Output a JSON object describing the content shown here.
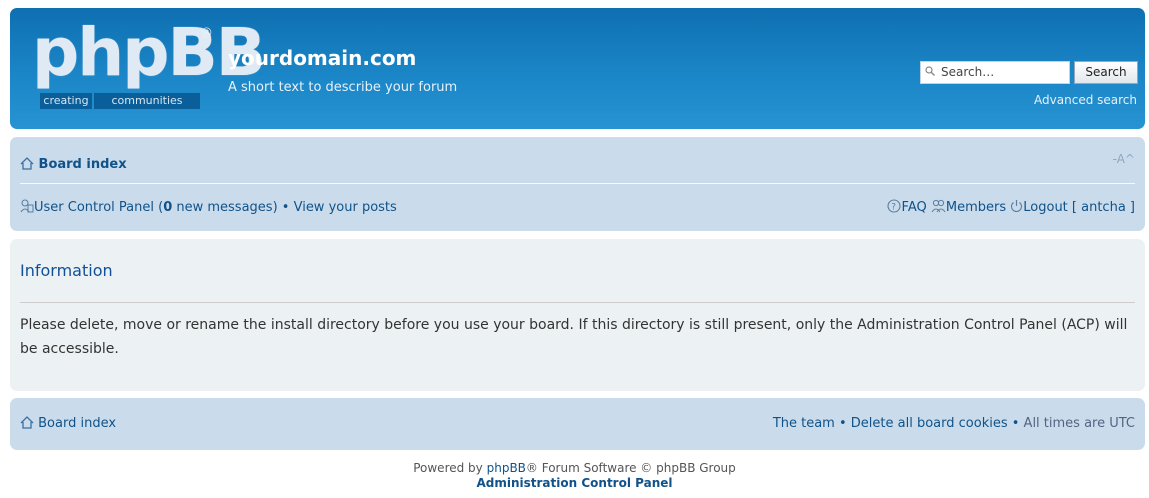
{
  "header": {
    "logo_text": "phpBB",
    "logo_registered": "®",
    "logo_sub1": "creating",
    "logo_sub2": "communities",
    "site_title": "yourdomain.com",
    "site_description": "A short text to describe your forum",
    "search_placeholder": "Search…",
    "search_button": "Search",
    "advanced_search": "Advanced search"
  },
  "navbar": {
    "board_index": "Board index",
    "font_size_control": "-A^",
    "ucp_label": "User Control Panel",
    "new_messages_count": "0",
    "new_messages_text": "new messages",
    "view_posts": "View your posts",
    "faq": "FAQ",
    "members": "Members",
    "logout": "Logout",
    "username": "antcha"
  },
  "info": {
    "title": "Information",
    "message": "Please delete, move or rename the install directory before you use your board. If this directory is still present, only the Administration Control Panel (ACP) will be accessible."
  },
  "footer_nav": {
    "board_index": "Board index",
    "team": "The team",
    "delete_cookies": "Delete all board cookies",
    "timezone": "All times are UTC"
  },
  "copyright": {
    "powered_by": "Powered by",
    "brand": "phpBB",
    "rest": "® Forum Software © phpBB Group",
    "acp_link": "Administration Control Panel"
  },
  "colors": {
    "header_blue": "#1b86c7",
    "nav_bg": "#cadceb",
    "panel_bg": "#ecf1f3",
    "link": "#105289"
  }
}
